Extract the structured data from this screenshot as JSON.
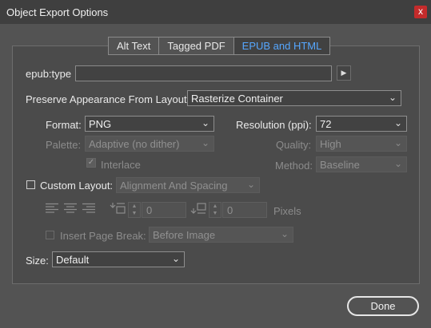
{
  "window": {
    "title": "Object Export Options",
    "close_glyph": "x"
  },
  "tabs": [
    {
      "label": "Alt Text",
      "active": false
    },
    {
      "label": "Tagged PDF",
      "active": false
    },
    {
      "label": "EPUB and HTML",
      "active": true
    }
  ],
  "epub_type": {
    "label": "epub:type",
    "value": "",
    "arrow_icon": "triangle-right-icon"
  },
  "preserve": {
    "label": "Preserve Appearance From Layout:",
    "value": "Rasterize Container"
  },
  "format": {
    "label": "Format:",
    "value": "PNG"
  },
  "resolution": {
    "label": "Resolution (ppi):",
    "value": "72"
  },
  "palette": {
    "label": "Palette:",
    "value": "Adaptive (no dither)"
  },
  "quality": {
    "label": "Quality:",
    "value": "High"
  },
  "interlace": {
    "label": "Interlace",
    "checked": true
  },
  "method": {
    "label": "Method:",
    "value": "Baseline"
  },
  "custom_layout": {
    "label": "Custom Layout:",
    "checked": false,
    "value": "Alignment And Spacing"
  },
  "spacing": {
    "before_value": "0",
    "after_value": "0",
    "unit": "Pixels"
  },
  "page_break": {
    "label": "Insert Page Break:",
    "checked": false,
    "value": "Before Image"
  },
  "size": {
    "label": "Size:",
    "value": "Default"
  },
  "buttons": {
    "done": "Done"
  },
  "glyphs": {
    "chevron": "⌄",
    "check": "✓",
    "spin_up": "▲",
    "spin_down": "▼",
    "arrow": "▶"
  },
  "colors": {
    "accent": "#56a7ff",
    "close": "#c42b2b",
    "background": "#535353"
  }
}
